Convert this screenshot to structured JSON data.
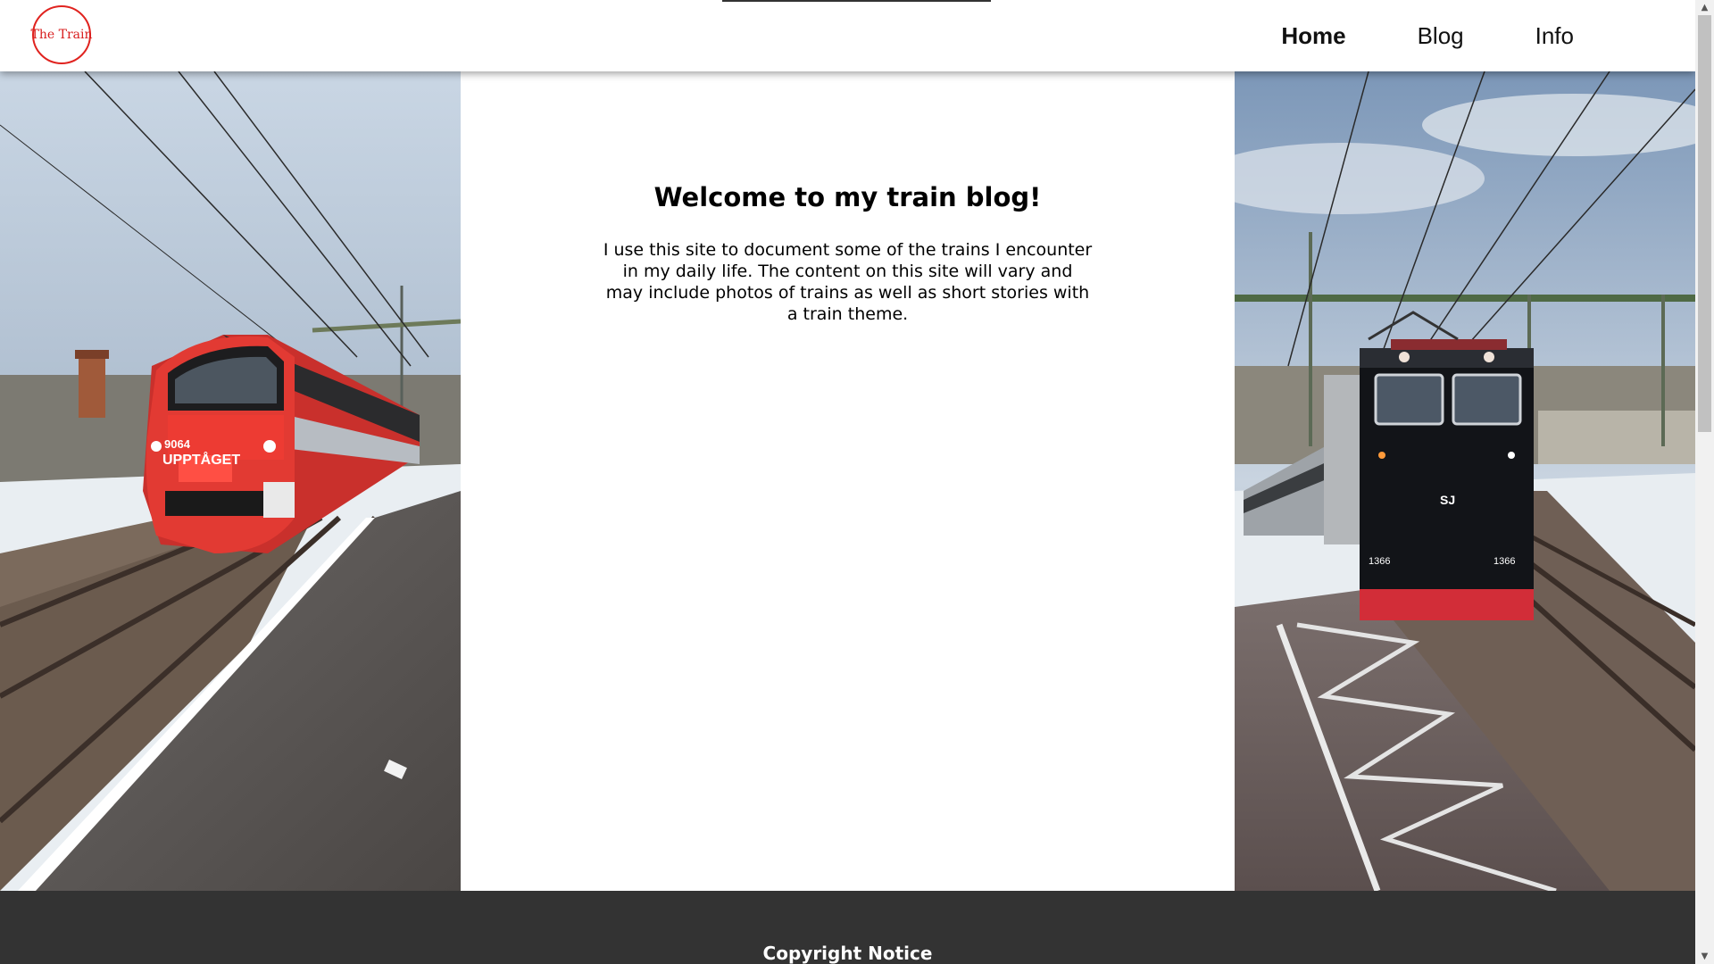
{
  "header": {
    "logo_text": "The Train",
    "nav": [
      {
        "label": "Home",
        "active": true
      },
      {
        "label": "Blog",
        "active": false
      },
      {
        "label": "Info",
        "active": false
      }
    ]
  },
  "main": {
    "title": "Welcome to my train blog!",
    "intro": "I use this site to document some of the trains I encounter in my daily life. The content on this site will vary and may include photos of trains as well as short stories with a train theme."
  },
  "photos": {
    "left": {
      "number": "9064",
      "brand": "UPPTÅGET"
    },
    "right": {
      "number_left": "1366",
      "number_right": "1366",
      "brand": "SJ"
    }
  },
  "footer": {
    "title": "Copyright Notice"
  },
  "colors": {
    "accent": "#e0231f",
    "footer_bg": "#333333"
  }
}
